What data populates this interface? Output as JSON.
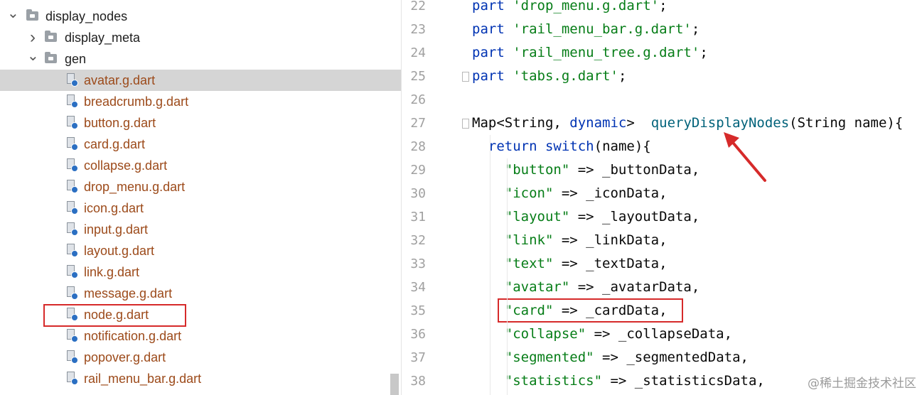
{
  "tree": {
    "rows": [
      {
        "label": "display_nodes",
        "kind": "dir",
        "expanded": true
      },
      {
        "label": "display_meta",
        "kind": "dir",
        "expanded": false
      },
      {
        "label": "gen",
        "kind": "dir",
        "expanded": true
      },
      {
        "label": "avatar.g.dart",
        "kind": "file",
        "selected": true
      },
      {
        "label": "breadcrumb.g.dart",
        "kind": "file"
      },
      {
        "label": "button.g.dart",
        "kind": "file"
      },
      {
        "label": "card.g.dart",
        "kind": "file"
      },
      {
        "label": "collapse.g.dart",
        "kind": "file"
      },
      {
        "label": "drop_menu.g.dart",
        "kind": "file"
      },
      {
        "label": "icon.g.dart",
        "kind": "file"
      },
      {
        "label": "input.g.dart",
        "kind": "file"
      },
      {
        "label": "layout.g.dart",
        "kind": "file"
      },
      {
        "label": "link.g.dart",
        "kind": "file"
      },
      {
        "label": "message.g.dart",
        "kind": "file"
      },
      {
        "label": "node.g.dart",
        "kind": "file",
        "highlighted": true
      },
      {
        "label": "notification.g.dart",
        "kind": "file"
      },
      {
        "label": "popover.g.dart",
        "kind": "file"
      },
      {
        "label": "rail_menu_bar.g.dart",
        "kind": "file"
      }
    ]
  },
  "editor": {
    "lines": [
      {
        "n": "22",
        "parts": [
          {
            "t": "part",
            "c": "kw"
          },
          {
            "t": " "
          },
          {
            "t": "'drop_menu.g.dart'",
            "c": "str"
          },
          {
            "t": ";"
          }
        ]
      },
      {
        "n": "23",
        "parts": [
          {
            "t": "part",
            "c": "kw"
          },
          {
            "t": " "
          },
          {
            "t": "'rail_menu_bar.g.dart'",
            "c": "str"
          },
          {
            "t": ";"
          }
        ]
      },
      {
        "n": "24",
        "parts": [
          {
            "t": "part",
            "c": "kw"
          },
          {
            "t": " "
          },
          {
            "t": "'rail_menu_tree.g.dart'",
            "c": "str"
          },
          {
            "t": ";"
          }
        ]
      },
      {
        "n": "25",
        "parts": [
          {
            "t": "part",
            "c": "kw"
          },
          {
            "t": " "
          },
          {
            "t": "'tabs.g.dart'",
            "c": "str"
          },
          {
            "t": ";"
          }
        ]
      },
      {
        "n": "26",
        "parts": []
      },
      {
        "n": "27",
        "parts": [
          {
            "t": "Map<String, "
          },
          {
            "t": "dynamic",
            "c": "kw"
          },
          {
            "t": ">  "
          },
          {
            "t": "queryDisplayNodes",
            "c": "fn"
          },
          {
            "t": "(String name){"
          }
        ]
      },
      {
        "n": "28",
        "parts": [
          {
            "t": "  "
          },
          {
            "t": "return",
            "c": "kw"
          },
          {
            "t": " "
          },
          {
            "t": "switch",
            "c": "kw"
          },
          {
            "t": "(name){"
          }
        ]
      },
      {
        "n": "29",
        "parts": [
          {
            "t": "    "
          },
          {
            "t": "\"button\"",
            "c": "str"
          },
          {
            "t": " => _buttonData,"
          }
        ]
      },
      {
        "n": "30",
        "parts": [
          {
            "t": "    "
          },
          {
            "t": "\"icon\"",
            "c": "str"
          },
          {
            "t": " => _iconData,"
          }
        ]
      },
      {
        "n": "31",
        "parts": [
          {
            "t": "    "
          },
          {
            "t": "\"layout\"",
            "c": "str"
          },
          {
            "t": " => _layoutData,"
          }
        ]
      },
      {
        "n": "32",
        "parts": [
          {
            "t": "    "
          },
          {
            "t": "\"link\"",
            "c": "str"
          },
          {
            "t": " => _linkData,"
          }
        ]
      },
      {
        "n": "33",
        "parts": [
          {
            "t": "    "
          },
          {
            "t": "\"text\"",
            "c": "str"
          },
          {
            "t": " => _textData,"
          }
        ]
      },
      {
        "n": "34",
        "parts": [
          {
            "t": "    "
          },
          {
            "t": "\"avatar\"",
            "c": "str"
          },
          {
            "t": " => _avatarData,"
          }
        ]
      },
      {
        "n": "35",
        "parts": [
          {
            "t": "    "
          },
          {
            "t": "\"card\"",
            "c": "str"
          },
          {
            "t": " => _cardData,"
          }
        ]
      },
      {
        "n": "36",
        "parts": [
          {
            "t": "    "
          },
          {
            "t": "\"collapse\"",
            "c": "str"
          },
          {
            "t": " => _collapseData,"
          }
        ]
      },
      {
        "n": "37",
        "parts": [
          {
            "t": "    "
          },
          {
            "t": "\"segmented\"",
            "c": "str"
          },
          {
            "t": " => _segmentedData,"
          }
        ]
      },
      {
        "n": "38",
        "parts": [
          {
            "t": "    "
          },
          {
            "t": "\"statistics\"",
            "c": "str"
          },
          {
            "t": " => _statisticsData,"
          }
        ]
      }
    ]
  },
  "watermark": "@稀土掘金技术社区",
  "colors": {
    "annotation_red": "#d62a2a",
    "keyword": "#0033b3",
    "string": "#067d17",
    "function": "#00627a",
    "file_label": "#9c4a1a",
    "selection": "#d5d5d5"
  }
}
